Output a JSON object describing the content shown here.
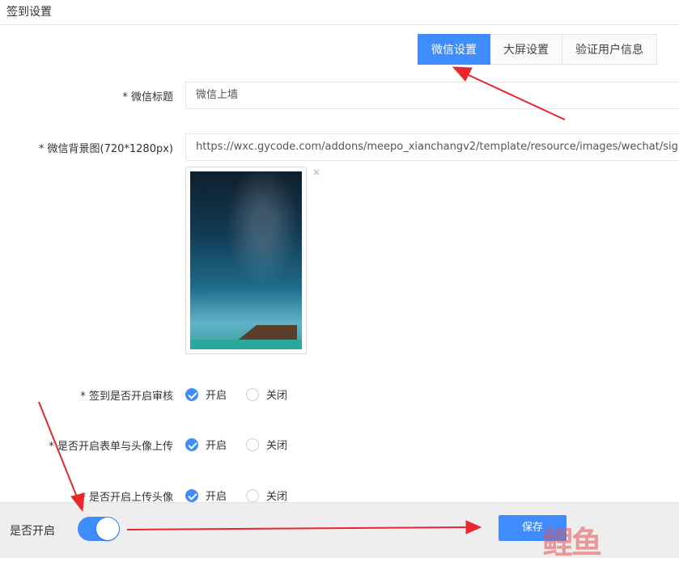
{
  "page_title": "签到设置",
  "tabs": [
    {
      "label": "微信设置",
      "active": true
    },
    {
      "label": "大屏设置",
      "active": false
    },
    {
      "label": "验证用户信息",
      "active": false
    }
  ],
  "fields": {
    "wechat_title": {
      "label": "* 微信标题",
      "value": "微信上墙"
    },
    "wechat_bg": {
      "label": "* 微信背景图(720*1280px)",
      "value": "https://wxc.gycode.com/addons/meepo_xianchangv2/template/resource/images/wechat/sign/ap"
    },
    "image_remove": "×"
  },
  "radio_groups": [
    {
      "label": "* 签到是否开启审核",
      "options": [
        "开启",
        "关闭"
      ],
      "selected": 0
    },
    {
      "label": "* 是否开启表单与头像上传",
      "options": [
        "开启",
        "关闭"
      ],
      "selected": 0
    },
    {
      "label": "* 是否开启上传头像",
      "options": [
        "开启",
        "关闭"
      ],
      "selected": 0
    }
  ],
  "bottom_bar": {
    "toggle_label": "是否开启",
    "toggle_on": true,
    "save_label": "保存",
    "watermark": "鲤鱼"
  },
  "colors": {
    "accent": "#3f8cff",
    "arrow": "#e8262d"
  }
}
